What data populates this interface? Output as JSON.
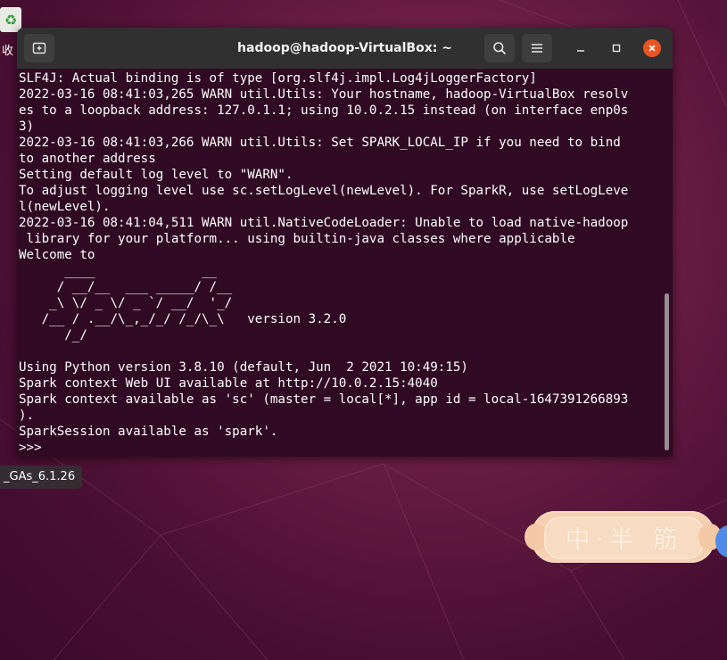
{
  "desktop": {
    "trash_label": "收",
    "file_label": "_GAs_6.1.26",
    "sticker_text": "中·半 筋"
  },
  "terminal": {
    "title": "hadoop@hadoop-VirtualBox: ~",
    "icons": {
      "new_tab": "new-tab-icon",
      "search": "search-icon",
      "menu": "hamburger-menu-icon",
      "minimize": "minimize-icon",
      "maximize": "maximize-icon",
      "close": "close-icon"
    },
    "colors": {
      "background": "#300a24",
      "titlebar": "#303030",
      "close_button": "#e95420",
      "text": "#ffffff"
    },
    "lines": [
      "SLF4J: Actual binding is of type [org.slf4j.impl.Log4jLoggerFactory]",
      "2022-03-16 08:41:03,265 WARN util.Utils: Your hostname, hadoop-VirtualBox resolv",
      "es to a loopback address: 127.0.1.1; using 10.0.2.15 instead (on interface enp0s",
      "3)",
      "2022-03-16 08:41:03,266 WARN util.Utils: Set SPARK_LOCAL_IP if you need to bind",
      "to another address",
      "Setting default log level to \"WARN\".",
      "To adjust logging level use sc.setLogLevel(newLevel). For SparkR, use setLogLeve",
      "l(newLevel).",
      "2022-03-16 08:41:04,511 WARN util.NativeCodeLoader: Unable to load native-hadoop",
      " library for your platform... using builtin-java classes where applicable",
      "Welcome to",
      "      ____              __",
      "     / __/__  ___ _____/ /__",
      "    _\\ \\/ _ \\/ _ `/ __/  '_/",
      "   /__ / .__/\\_,_/_/ /_/\\_\\   version 3.2.0",
      "      /_/",
      "",
      "Using Python version 3.8.10 (default, Jun  2 2021 10:49:15)",
      "Spark context Web UI available at http://10.0.2.15:4040",
      "Spark context available as 'sc' (master = local[*], app id = local-1647391266893",
      ").",
      "SparkSession available as 'spark'.",
      ">>> "
    ]
  }
}
